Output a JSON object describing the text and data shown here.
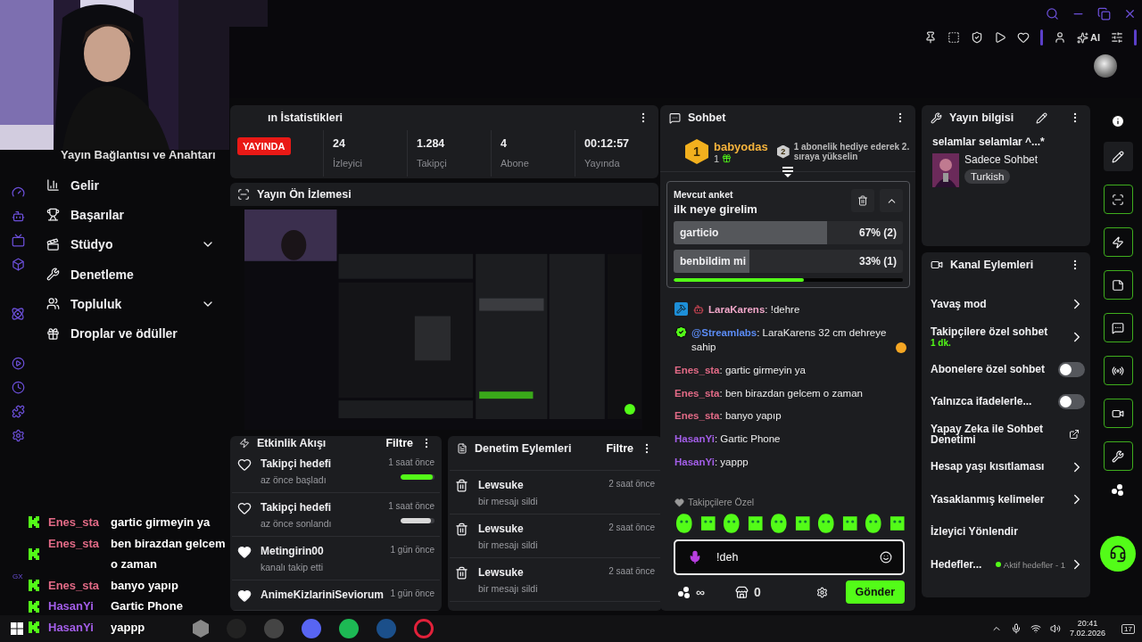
{
  "toolbar": {
    "ai_label": "AI"
  },
  "sidebar": {
    "title": "Yayın Bağlantısı ve Anahtarı",
    "items": [
      {
        "label": "Gelir",
        "has_submenu": false
      },
      {
        "label": "Başarılar",
        "has_submenu": false
      },
      {
        "label": "Stüdyo",
        "has_submenu": true
      },
      {
        "label": "Denetleme",
        "has_submenu": false
      },
      {
        "label": "Topluluk",
        "has_submenu": true
      },
      {
        "label": "Droplar ve ödüller",
        "has_submenu": false
      }
    ]
  },
  "stats": {
    "title": "ın İstatistikleri",
    "status": "YAYINDA",
    "values": [
      {
        "value": "24",
        "label": "İzleyici"
      },
      {
        "value": "1.284",
        "label": "Takipçi"
      },
      {
        "value": "4",
        "label": "Abone"
      },
      {
        "value": "00:12:57",
        "label": "Yayında"
      }
    ]
  },
  "preview": {
    "title": "Yayın Ön İzlemesi"
  },
  "activity": {
    "title": "Etkinlik Akışı",
    "filter": "Filtre",
    "items": [
      {
        "kind": "goal",
        "title": "Takipçi hedefi",
        "subtitle": "az önce başladı",
        "time": "1 saat önce",
        "active": true,
        "level": 0.95
      },
      {
        "kind": "goal",
        "title": "Takipçi hedefi",
        "subtitle": "az önce sonlandı",
        "time": "1 saat önce",
        "active": false,
        "level": 0.9
      },
      {
        "kind": "follow",
        "title": "Metingirin00",
        "subtitle": "kanalı takip etti",
        "time": "1 gün önce"
      },
      {
        "kind": "follow",
        "title": "AnimeKizlariniSeviorum",
        "time": "1 gün önce"
      }
    ]
  },
  "mod_actions": {
    "title": "Denetim Eylemleri",
    "filter": "Filtre",
    "items": [
      {
        "user": "Lewsuke",
        "action": "bir mesajı sildi",
        "time": "2 saat önce"
      },
      {
        "user": "Lewsuke",
        "action": "bir mesajı sildi",
        "time": "2 saat önce"
      },
      {
        "user": "Lewsuke",
        "action": "bir mesajı sildi",
        "time": "2 saat önce"
      }
    ]
  },
  "chat": {
    "title": "Sohbet",
    "leader": {
      "rank": "1",
      "name": "babyodas",
      "count": "1",
      "next_rank": "2",
      "hint": "1 abonelik hediye ederek 2. sıraya yükselin"
    },
    "poll": {
      "label": "Mevcut anket",
      "question": "ilk neye girelim",
      "options": [
        {
          "text": "garticio",
          "result": "67% (2)",
          "level": 0.67
        },
        {
          "text": "benbildim mi",
          "result": "33% (1)",
          "level": 0.33
        }
      ],
      "timer": {
        "level": 0.57
      }
    },
    "messages": [
      {
        "kind": "mod",
        "user": "LaraKarens",
        "text": ": !dehre",
        "color": "#f0a6c8"
      },
      {
        "kind": "bot",
        "user": "@Streamlabs",
        "text": ": LaraKarens 32 cm dehreye sahip",
        "color": "#5b8cf5"
      },
      {
        "kind": "plain",
        "user": "Enes_sta",
        "text": ": gartic girmeyin ya",
        "color": "#e26a86"
      },
      {
        "kind": "plain",
        "user": "Enes_sta",
        "text": ": ben birazdan gelcem o zaman",
        "color": "#e26a86"
      },
      {
        "kind": "plain",
        "user": "Enes_sta",
        "text": ": banyo yapıp",
        "color": "#e26a86"
      },
      {
        "kind": "plain",
        "user": "HasanYi",
        "text": ": Gartic Phone",
        "color": "#a35ee8"
      },
      {
        "kind": "plain",
        "user": "HasanYi",
        "text": ": yappp",
        "color": "#a35ee8"
      }
    ],
    "emote_label": "Takipçilere Özel",
    "input": {
      "value": "!deh"
    },
    "points_label": "∞",
    "store_count": "0",
    "send": "Gönder"
  },
  "stream_info": {
    "title": "Yayın bilgisi",
    "stream_title": "selamlar selamlar ^...*",
    "category": "Sadece Sohbet",
    "tag": "Turkish"
  },
  "channel_actions": {
    "title": "Kanal Eylemleri",
    "items": [
      {
        "kind": "link",
        "label": "Yavaş mod"
      },
      {
        "kind": "link",
        "label": "Takipçilere özel sohbet",
        "detail": "1 dk."
      },
      {
        "kind": "toggle",
        "label": "Abonelere özel sohbet",
        "on": false
      },
      {
        "kind": "toggle",
        "label": "Yalnızca ifadelerle...",
        "on": false
      },
      {
        "kind": "external",
        "label": "Yapay Zeka ile Sohbet Denetimi"
      },
      {
        "kind": "link",
        "label": "Hesap yaşı kısıtlaması"
      },
      {
        "kind": "link",
        "label": "Yasaklanmış kelimeler"
      },
      {
        "kind": "plain",
        "label": "İzleyici Yönlendir"
      },
      {
        "kind": "link",
        "label": "Hedefler...",
        "status": "Aktif hedefler - 1",
        "color": "#53fc18"
      }
    ]
  },
  "overlay_chat": {
    "side_label": "GX",
    "messages": [
      {
        "user": "Enes_sta",
        "text": "gartic girmeyin ya",
        "color": "#e26a86"
      },
      {
        "user": "Enes_sta",
        "text": "ben birazdan gelcem o zaman",
        "color": "#e26a86"
      },
      {
        "user": "Enes_sta",
        "text": "banyo yapıp",
        "color": "#e26a86"
      },
      {
        "user": "HasanYi",
        "text": "Gartic Phone",
        "color": "#a35ee8"
      },
      {
        "user": "HasanYi",
        "text": "yappp",
        "color": "#a35ee8"
      }
    ]
  },
  "taskbar": {
    "time": "20:41",
    "date": "7.02.2026",
    "notifications": "17"
  }
}
